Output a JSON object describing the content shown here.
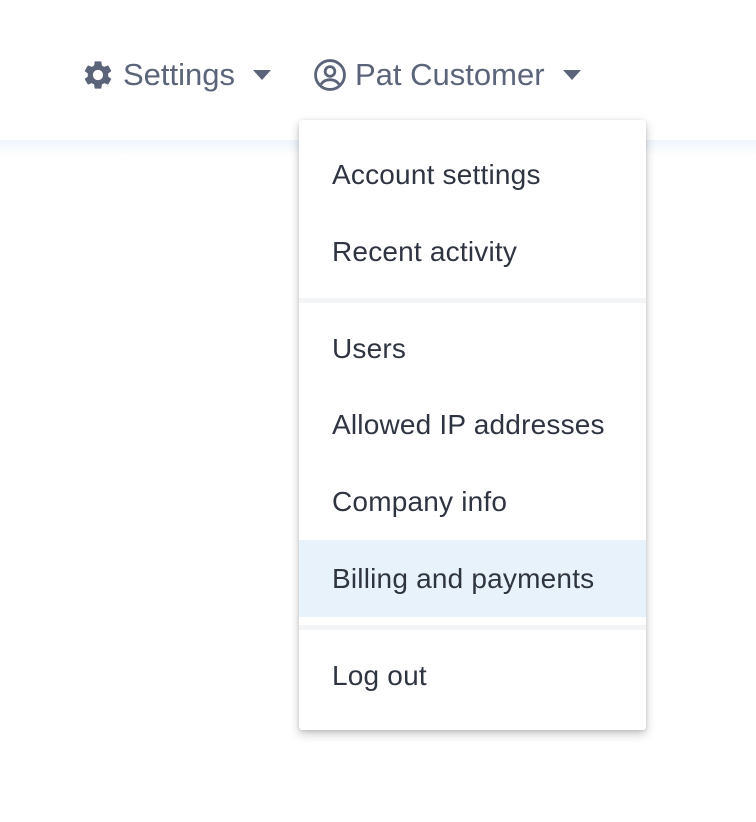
{
  "nav": {
    "settings": {
      "label": "Settings",
      "icon": "gear-icon"
    },
    "user": {
      "label": "Pat Customer",
      "icon": "user-circle-icon"
    }
  },
  "dropdown": {
    "items": [
      {
        "label": "Account settings"
      },
      {
        "label": "Recent activity"
      },
      {
        "label": "Users"
      },
      {
        "label": "Allowed IP addresses"
      },
      {
        "label": "Company info"
      },
      {
        "label": "Billing and payments",
        "active": true
      },
      {
        "label": "Log out"
      }
    ]
  },
  "colors": {
    "nav_text": "#5b6479",
    "menu_text": "#2f3441",
    "active_bg": "#e8f2fb"
  }
}
